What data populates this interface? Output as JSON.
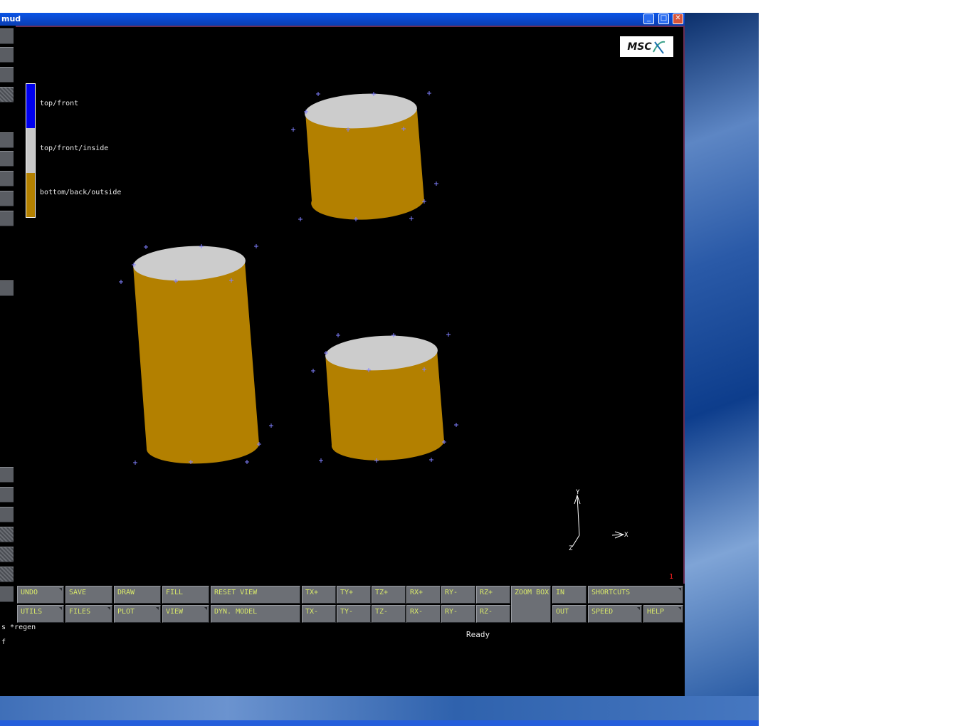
{
  "window": {
    "title": "mud",
    "minimize_glyph": "_",
    "maximize_glyph": "□",
    "close_glyph": "✕"
  },
  "logo": {
    "text": "MSC"
  },
  "legend": {
    "items": [
      {
        "label": "top/front",
        "color": "#0000ee"
      },
      {
        "label": "top/front/inside",
        "color": "#c8c8c8"
      },
      {
        "label": "bottom/back/outside",
        "color": "#b38000"
      }
    ]
  },
  "viewport": {
    "number": "1",
    "axis_labels": {
      "y": "Y",
      "x": "X",
      "z": "Z"
    },
    "colors": {
      "cap": "#cccccc",
      "body": "#b38000",
      "marker": "#8080ff"
    }
  },
  "toolbar": {
    "row1": [
      {
        "label": "UNDO",
        "menu": true
      },
      {
        "label": "SAVE",
        "menu": false
      },
      {
        "label": "DRAW",
        "menu": false
      },
      {
        "label": "FILL",
        "menu": false
      },
      {
        "label": "RESET VIEW",
        "menu": false
      },
      {
        "label": "TX+",
        "menu": false
      },
      {
        "label": "TY+",
        "menu": false
      },
      {
        "label": "TZ+",
        "menu": false
      },
      {
        "label": "RX+",
        "menu": false
      },
      {
        "label": "RY-",
        "menu": false
      },
      {
        "label": "RZ+",
        "menu": false
      },
      {
        "label": "IN",
        "menu": false
      },
      {
        "label": "SHORTCUTS",
        "menu": true
      }
    ],
    "row2": [
      {
        "label": "UTILS",
        "menu": true
      },
      {
        "label": "FILES",
        "menu": true
      },
      {
        "label": "PLOT",
        "menu": true
      },
      {
        "label": "VIEW",
        "menu": true
      },
      {
        "label": "DYN. MODEL",
        "menu": false
      },
      {
        "label": "TX-",
        "menu": false
      },
      {
        "label": "TY-",
        "menu": false
      },
      {
        "label": "TZ-",
        "menu": false
      },
      {
        "label": "RX-",
        "menu": false
      },
      {
        "label": "RY-",
        "menu": false
      },
      {
        "label": "RZ-",
        "menu": false
      },
      {
        "label": "OUT",
        "menu": false
      },
      {
        "label": "SPEED",
        "menu": true
      },
      {
        "label": "HELP",
        "menu": true
      }
    ],
    "zoom_box": "ZOOM BOX"
  },
  "console": {
    "lines": [
      "s *regen",
      "f"
    ],
    "status": "Ready"
  }
}
